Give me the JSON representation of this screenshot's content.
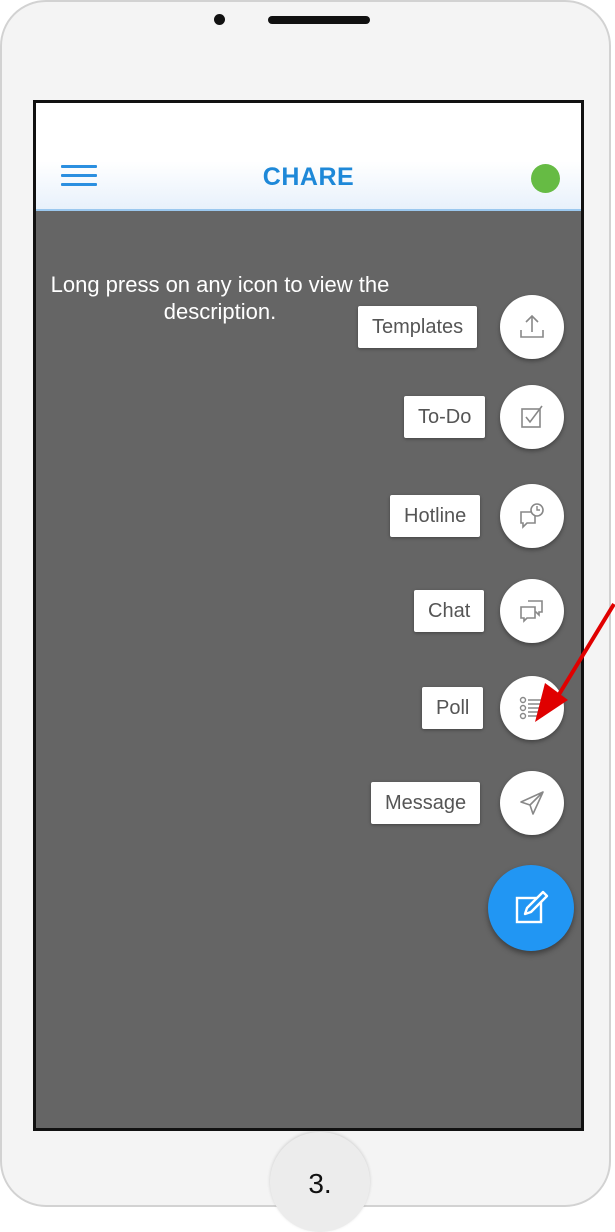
{
  "app": {
    "title": "CHARE",
    "status_color": "#66bb44",
    "accent_color": "#1e88d8"
  },
  "overlay": {
    "hint": "Long press on any icon to view the description."
  },
  "fab_menu": {
    "items": [
      {
        "label": "Templates",
        "icon": "upload-icon"
      },
      {
        "label": "To-Do",
        "icon": "checkbox-icon"
      },
      {
        "label": "Hotline",
        "icon": "hotline-chat-icon"
      },
      {
        "label": "Chat",
        "icon": "chat-bubbles-icon"
      },
      {
        "label": "Poll",
        "icon": "list-icon"
      },
      {
        "label": "Message",
        "icon": "send-icon"
      }
    ],
    "main_icon": "compose-icon",
    "main_color": "#2196f3"
  },
  "annotation": {
    "step": "3.",
    "arrow_color": "#e00000"
  }
}
